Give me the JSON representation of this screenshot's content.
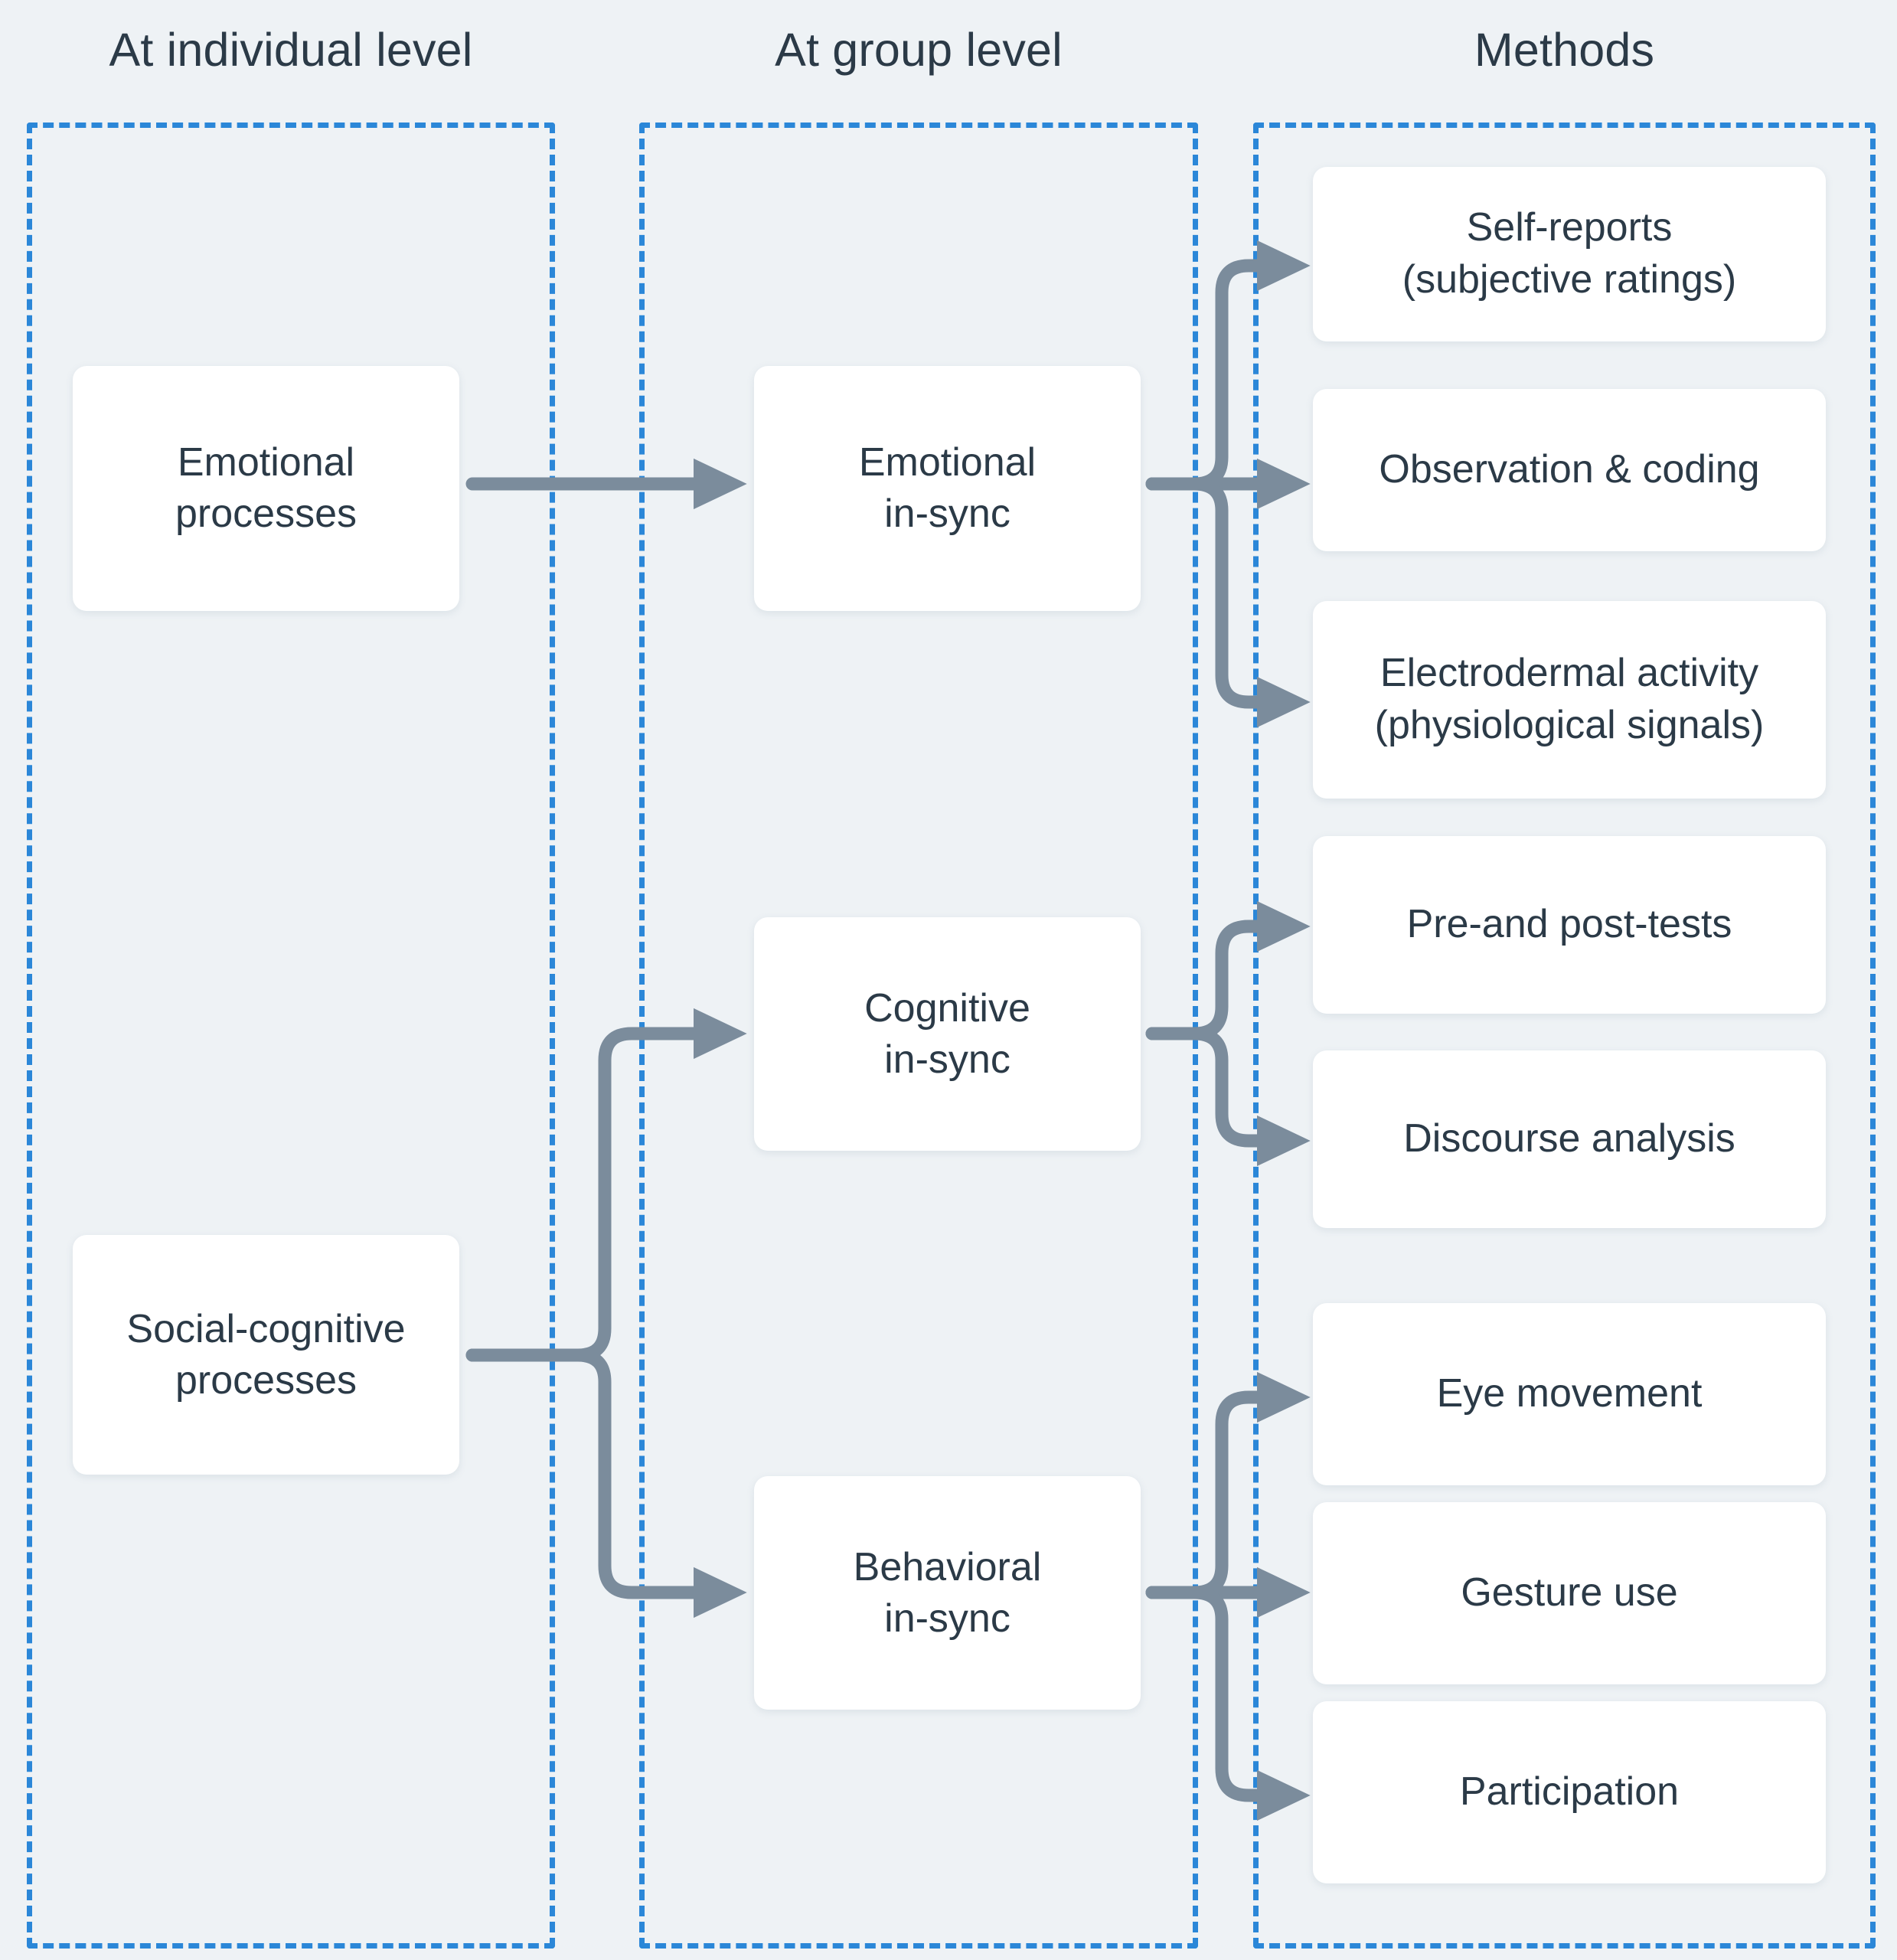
{
  "columns": [
    {
      "id": "individual",
      "title": "At individual level"
    },
    {
      "id": "group",
      "title": "At group level"
    },
    {
      "id": "methods",
      "title": "Methods"
    }
  ],
  "individual_nodes": [
    {
      "id": "emotional-processes",
      "label": "Emotional\nprocesses"
    },
    {
      "id": "social-cognitive-processes",
      "label": "Social-cognitive\nprocesses"
    }
  ],
  "group_nodes": [
    {
      "id": "emotional-in-sync",
      "label": "Emotional\nin-sync"
    },
    {
      "id": "cognitive-in-sync",
      "label": "Cognitive\nin-sync"
    },
    {
      "id": "behavioral-in-sync",
      "label": "Behavioral\nin-sync"
    }
  ],
  "method_nodes": [
    {
      "id": "self-reports",
      "label": "Self-reports\n(subjective ratings)"
    },
    {
      "id": "observation-coding",
      "label": "Observation & coding"
    },
    {
      "id": "electrodermal",
      "label": "Electrodermal activity\n(physiological signals)"
    },
    {
      "id": "pre-post-tests",
      "label": "Pre-and post-tests"
    },
    {
      "id": "discourse-analysis",
      "label": "Discourse analysis"
    },
    {
      "id": "eye-movement",
      "label": "Eye movement"
    },
    {
      "id": "gesture-use",
      "label": "Gesture use"
    },
    {
      "id": "participation",
      "label": "Participation"
    }
  ],
  "links": [
    {
      "from": "emotional-processes",
      "to": "emotional-in-sync"
    },
    {
      "from": "social-cognitive-processes",
      "to": "cognitive-in-sync"
    },
    {
      "from": "social-cognitive-processes",
      "to": "behavioral-in-sync"
    },
    {
      "from": "emotional-in-sync",
      "to": "self-reports"
    },
    {
      "from": "emotional-in-sync",
      "to": "observation-coding"
    },
    {
      "from": "emotional-in-sync",
      "to": "electrodermal"
    },
    {
      "from": "cognitive-in-sync",
      "to": "pre-post-tests"
    },
    {
      "from": "cognitive-in-sync",
      "to": "discourse-analysis"
    },
    {
      "from": "behavioral-in-sync",
      "to": "eye-movement"
    },
    {
      "from": "behavioral-in-sync",
      "to": "gesture-use"
    },
    {
      "from": "behavioral-in-sync",
      "to": "participation"
    }
  ],
  "colors": {
    "background": "#eef2f5",
    "dashed_border": "#2b87d8",
    "card_background": "#ffffff",
    "text": "#2b3a47",
    "arrow": "#7b8c9c"
  }
}
